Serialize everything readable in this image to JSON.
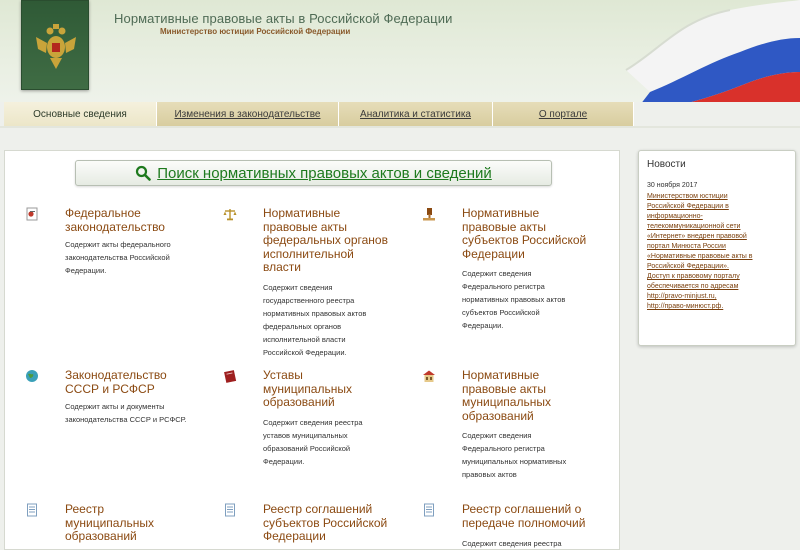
{
  "header": {
    "title": "Нормативные правовые акты в Российской Федерации",
    "subtitle": "Министерство юстиции Российской Федерации",
    "emblem_icon": "coat-of-arms-icon",
    "flag_icon": "russian-flag-icon"
  },
  "tabs": [
    {
      "label": "Основные сведения",
      "active": true
    },
    {
      "label": "Изменения в законодательстве",
      "active": false
    },
    {
      "label": "Аналитика и статистика",
      "active": false
    },
    {
      "label": "О портале",
      "active": false
    }
  ],
  "search": {
    "label": "Поиск нормативных правовых актов и сведений",
    "icon": "search-icon"
  },
  "items": [
    {
      "title": "Федеральное законодательство",
      "title_lines": [
        "Федеральное",
        "законодательство"
      ],
      "desc_lines": [
        "Содержит акты федерального",
        "законодательства Российской",
        "Федерации."
      ],
      "icon": "law-document-icon"
    },
    {
      "title": "Нормативные правовые акты федеральных органов исполнительной власти",
      "title_lines": [
        "Нормативные",
        "правовые акты",
        "федеральных органов",
        "исполнительной",
        "власти"
      ],
      "desc_lines": [
        "Содержит сведения",
        "государственного реестра",
        "нормативных правовых актов",
        "федеральных органов",
        "исполнительной власти",
        "Российской Федерации."
      ],
      "icon": "scales-icon"
    },
    {
      "title": "Нормативные правовые акты субъектов Российской Федерации",
      "title_lines": [
        "Нормативные",
        "правовые акты",
        "субъектов Российской",
        "Федерации"
      ],
      "desc_lines": [
        "Содержит сведения",
        "Федерального регистра",
        "нормативных правовых актов",
        "субъектов Российской",
        "Федерации."
      ],
      "icon": "gavel-icon"
    },
    {
      "title": "Законодательство СССР и РСФСР",
      "title_lines": [
        "Законодательство",
        "СССР и РСФСР"
      ],
      "desc_lines": [
        "Содержит акты и документы",
        "законодательства СССР и РСФСР."
      ],
      "icon": "globe-icon"
    },
    {
      "title": "Уставы муниципальных образований",
      "title_lines": [
        "Уставы",
        "муниципальных",
        "образований"
      ],
      "desc_lines": [
        "Содержит сведения реестра",
        "уставов муниципальных",
        "образований Российской",
        "Федерации."
      ],
      "icon": "book-icon"
    },
    {
      "title": "Нормативные правовые акты муниципальных образований",
      "title_lines": [
        "Нормативные",
        "правовые акты",
        "муниципальных",
        "образований"
      ],
      "desc_lines": [
        "Содержит сведения",
        "Федерального регистра",
        "муниципальных нормативных",
        "правовых актов"
      ],
      "icon": "building-icon"
    },
    {
      "title": "Реестр муниципальных образований",
      "title_lines": [
        "Реестр",
        "муниципальных",
        "образований"
      ],
      "desc_lines": [],
      "icon": "registry-document-icon"
    },
    {
      "title": "Реестр соглашений субъектов Российской Федерации",
      "title_lines": [
        "Реестр соглашений",
        "субъектов Российской",
        "Федерации"
      ],
      "desc_lines": [],
      "icon": "agreement-document-icon"
    },
    {
      "title": "Реестр соглашений о передаче полномочий",
      "title_lines": [
        "Реестр соглашений о",
        "передаче полномочий"
      ],
      "desc_lines": [
        "Содержит сведения реестра"
      ],
      "icon": "transfer-document-icon"
    }
  ],
  "news": {
    "heading": "Новости",
    "date": "30 ноября 2017",
    "lines": [
      "Министерством юстиции",
      "Российской Федерации в",
      "информационно-",
      "телекоммуникационной сети",
      "«Интернет» внедрен правовой",
      "портал Минюста России",
      "«Нормативные правовые акты в",
      "Российской Федерации».",
      "Доступ к правовому порталу",
      "обеспечивается по адресам",
      "http://pravo-minjust.ru,",
      "http://право-минюст.рф."
    ]
  },
  "colors": {
    "title_link": "#8b4a12",
    "search_link": "#1e7a1e",
    "emblem_bg": "#3f6c44",
    "tab_bg": "#d8cd9f"
  }
}
